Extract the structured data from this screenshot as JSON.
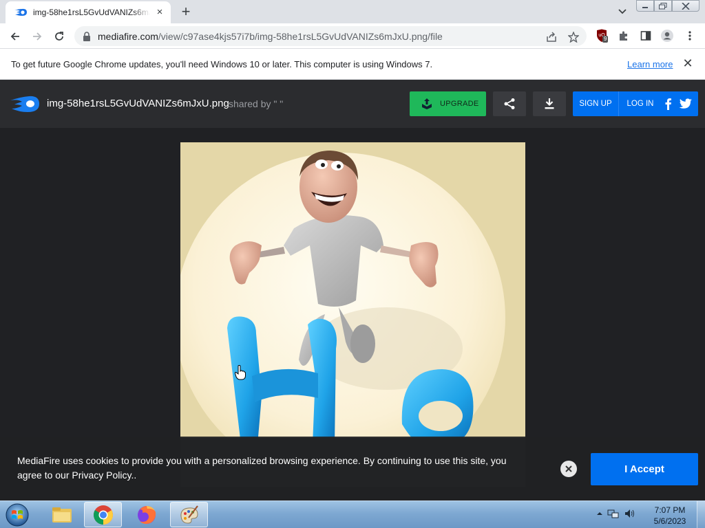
{
  "browser": {
    "tab": {
      "title": "img-58he1rsL5GvUdVANIZs6mJxU.png",
      "favicon": "mediafire-icon",
      "close": "×"
    },
    "new_tab": "+",
    "url": {
      "host": "mediafire.com",
      "path": "/view/c97ase4kjs57i7b/img-58he1rsL5GvUdVANIZs6mJxU.png/file"
    },
    "extension_badge": "9"
  },
  "infobar": {
    "message": "To get future Google Chrome updates, you'll need Windows 10 or later. This computer is using Windows 7.",
    "learn_more": "Learn more",
    "close": "✕"
  },
  "mediafire": {
    "filename": "img-58he1rsL5GvUdVANIZs6mJxU.png",
    "shared_by": "shared by \" \"",
    "upgrade": "UPGRADE",
    "sign_up": "SIGN UP",
    "log_in": "LOG IN",
    "brand_blue": "#0070f0",
    "upgrade_green": "#1fb85a"
  },
  "preview": {
    "image_name": "img-58he1rsL5GvUdVANIZs6mJxU.png",
    "letters": "HP"
  },
  "cookie": {
    "text": "MediaFire uses cookies to provide you with a personalized browsing experience. By continuing to use this site, you agree to our Privacy Policy..",
    "accept": "I Accept"
  },
  "taskbar": {
    "items": [
      "windows-explorer",
      "google-chrome",
      "firefox",
      "paint"
    ],
    "time": "7:07 PM",
    "date": "5/6/2023"
  }
}
